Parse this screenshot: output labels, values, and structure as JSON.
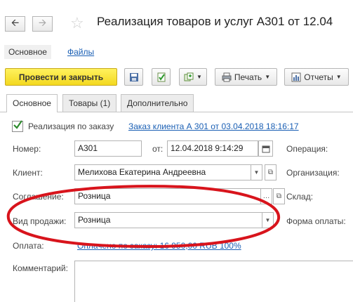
{
  "header": {
    "title": "Реализация товаров и услуг А301 от 12.04",
    "back_icon": "arrow-left-icon",
    "forward_icon": "arrow-right-icon",
    "favorite_icon": "star-icon"
  },
  "nav_links": {
    "main": "Основное",
    "files": "Файлы"
  },
  "toolbar": {
    "post_close": "Провести и закрыть",
    "print": "Печать",
    "reports": "Отчеты"
  },
  "tabs": [
    "Основное",
    "Товары (1)",
    "Дополнительно"
  ],
  "form": {
    "by_order_label": "Реализация по заказу",
    "by_order_checked": true,
    "order_link": "Заказ клиента А 301 от 03.04.2018 18:16:17",
    "number_label": "Номер:",
    "number_value": "А301",
    "from_label": "от:",
    "date_value": "12.04.2018  9:14:29",
    "operation_label": "Операция:",
    "client_label": "Клиент:",
    "client_value": "Мелихова Екатерина Андреевна",
    "organization_label": "Организация:",
    "agreement_label": "Соглашение:",
    "agreement_value": "Розница",
    "warehouse_label": "Склад:",
    "sale_type_label": "Вид продажи:",
    "sale_type_value": "Розница",
    "payment_form_label": "Форма оплаты:",
    "payment_label": "Оплата:",
    "payment_link": "Оплачено по заказу: 16 950,00 RUB  100%",
    "comment_label": "Комментарий:"
  },
  "colors": {
    "annotation_ellipse": "#d8141c",
    "primary_button": "#f5dc2a",
    "link": "#1a5fb4"
  }
}
